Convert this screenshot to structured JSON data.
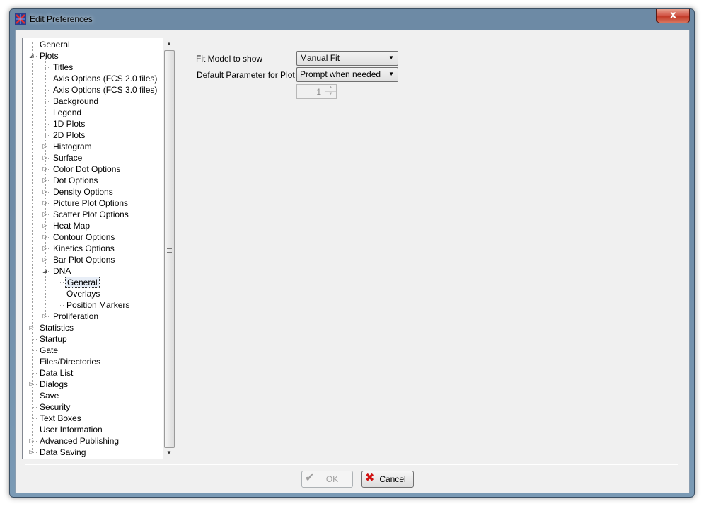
{
  "window": {
    "title": "Edit Preferences",
    "close_glyph": "x",
    "accent_color": "#6f8ca7"
  },
  "tree": {
    "items": [
      {
        "label": "General",
        "expander": ""
      },
      {
        "label": "Plots",
        "expander": "expanded"
      },
      {
        "label": "Titles",
        "expander": ""
      },
      {
        "label": "Axis Options (FCS 2.0 files)",
        "expander": ""
      },
      {
        "label": "Axis Options (FCS 3.0 files)",
        "expander": ""
      },
      {
        "label": "Background",
        "expander": ""
      },
      {
        "label": "Legend",
        "expander": ""
      },
      {
        "label": "1D Plots",
        "expander": ""
      },
      {
        "label": "2D Plots",
        "expander": ""
      },
      {
        "label": "Histogram",
        "expander": "collapsed"
      },
      {
        "label": "Surface",
        "expander": "collapsed"
      },
      {
        "label": "Color Dot Options",
        "expander": "collapsed"
      },
      {
        "label": "Dot Options",
        "expander": "collapsed"
      },
      {
        "label": "Density Options",
        "expander": "collapsed"
      },
      {
        "label": "Picture Plot Options",
        "expander": "collapsed"
      },
      {
        "label": "Scatter Plot Options",
        "expander": "collapsed"
      },
      {
        "label": "Heat Map",
        "expander": "collapsed"
      },
      {
        "label": "Contour Options",
        "expander": "collapsed"
      },
      {
        "label": "Kinetics Options",
        "expander": "collapsed"
      },
      {
        "label": "Bar Plot Options",
        "expander": "collapsed"
      },
      {
        "label": "DNA",
        "expander": "expanded"
      },
      {
        "label": "General",
        "expander": "",
        "selected": true
      },
      {
        "label": "Overlays",
        "expander": ""
      },
      {
        "label": "Position Markers",
        "expander": ""
      },
      {
        "label": "Proliferation",
        "expander": "collapsed"
      },
      {
        "label": "Statistics",
        "expander": "collapsed"
      },
      {
        "label": "Startup",
        "expander": ""
      },
      {
        "label": "Gate",
        "expander": ""
      },
      {
        "label": "Files/Directories",
        "expander": ""
      },
      {
        "label": "Data List",
        "expander": ""
      },
      {
        "label": "Dialogs",
        "expander": "collapsed"
      },
      {
        "label": "Save",
        "expander": ""
      },
      {
        "label": "Security",
        "expander": ""
      },
      {
        "label": "Text Boxes",
        "expander": ""
      },
      {
        "label": "User Information",
        "expander": ""
      },
      {
        "label": "Advanced Publishing",
        "expander": "collapsed"
      },
      {
        "label": "Data Saving",
        "expander": "collapsed"
      }
    ]
  },
  "form": {
    "fit_model_label": "Fit Model to show",
    "fit_model_value": "Manual Fit",
    "default_param_label": "Default Parameter for Plot",
    "default_param_value": "Prompt when needed",
    "param_number_value": "1"
  },
  "buttons": {
    "ok_label": "OK",
    "cancel_label": "Cancel"
  }
}
